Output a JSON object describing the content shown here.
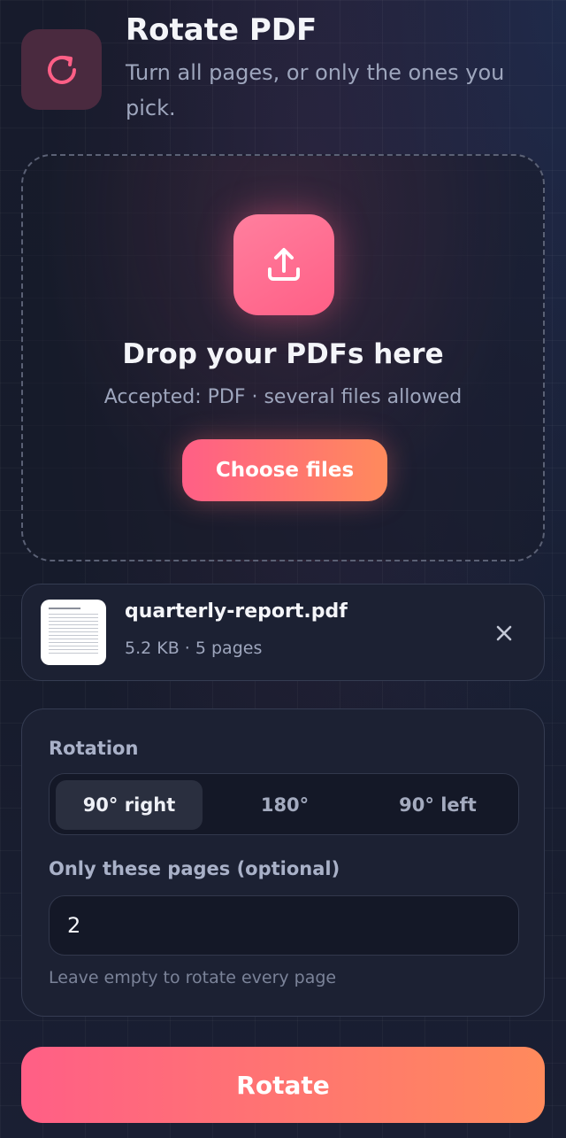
{
  "header": {
    "title": "Rotate PDF",
    "subtitle": "Turn all pages, or only the ones you pick.",
    "icon": "rotate-icon"
  },
  "dropzone": {
    "icon": "upload-icon",
    "title": "Drop your PDFs here",
    "subtitle": "Accepted: PDF · several files allowed",
    "button_label": "Choose files"
  },
  "file": {
    "name": "quarterly-report.pdf",
    "meta": "5.2 KB · 5 pages",
    "remove_icon": "close-icon"
  },
  "options": {
    "rotation_label": "Rotation",
    "rotation_options": [
      "90° right",
      "180°",
      "90° left"
    ],
    "selected_rotation": "90° right",
    "pages_label": "Only these pages (optional)",
    "pages_value": "2",
    "hint": "Leave empty to rotate every page"
  },
  "action": {
    "rotate_label": "Rotate"
  },
  "colors": {
    "accent_start": "#ff5f86",
    "accent_end": "#ff8a5c",
    "background": "#161b2b",
    "card": "#1c2133"
  }
}
